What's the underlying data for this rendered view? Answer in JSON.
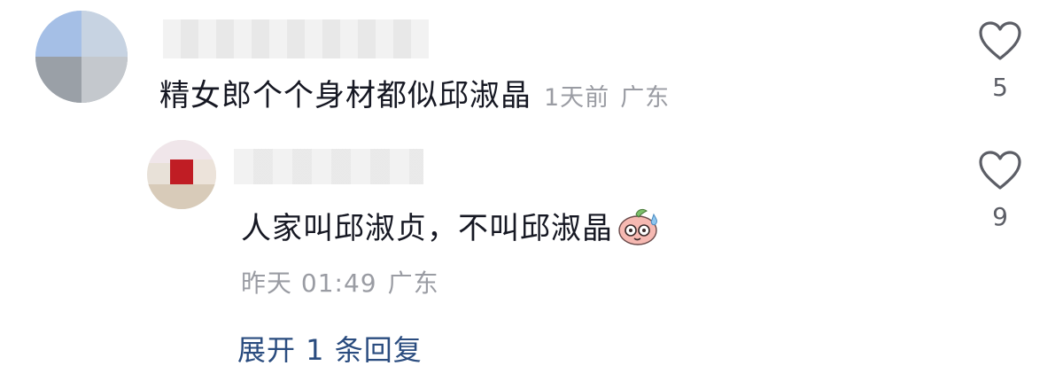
{
  "comment": {
    "text": "精女郎个个身材都似邱淑晶",
    "time": "1天前",
    "location": "广东",
    "likes": "5"
  },
  "reply": {
    "text": "人家叫邱淑贞，不叫邱淑晶",
    "emoji": "sweat-smile-peach-emoji",
    "time": "昨天 01:49",
    "location": "广东",
    "likes": "9"
  },
  "expand_replies": "展开 1 条回复",
  "colors": {
    "text": "#161823",
    "meta": "#9a9ca3",
    "link": "#2a4c7f",
    "like_icon": "#5c5e66"
  }
}
